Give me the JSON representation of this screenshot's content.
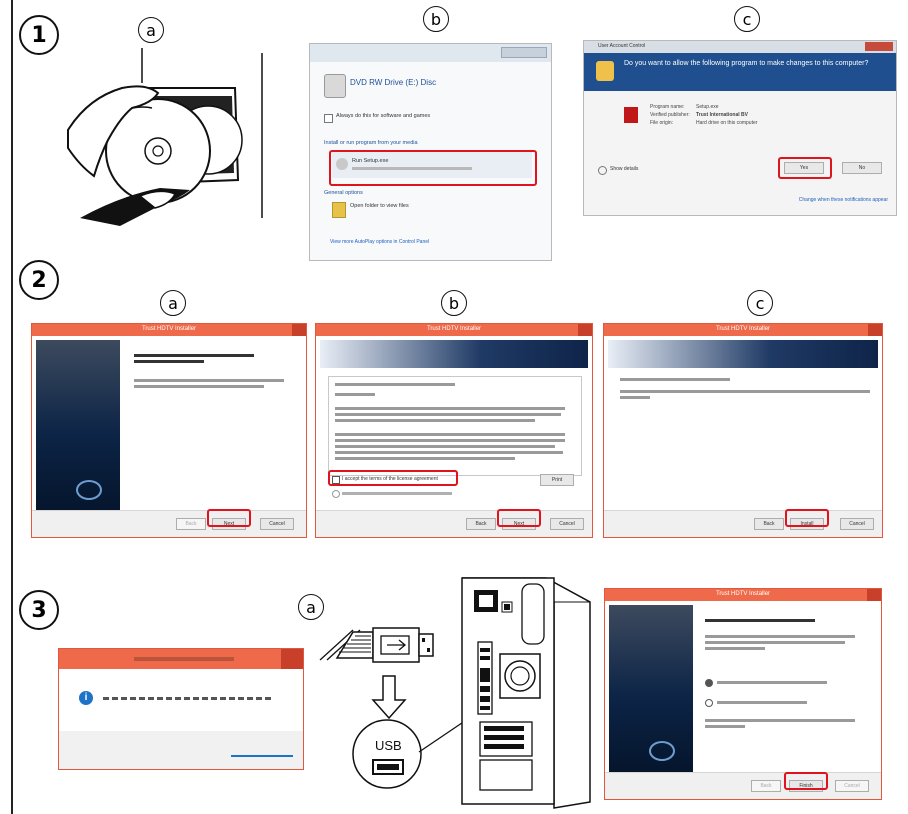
{
  "steps": [
    {
      "number": "1",
      "subs": [
        "a",
        "b",
        "c"
      ]
    },
    {
      "number": "2",
      "subs": [
        "a",
        "b",
        "c"
      ]
    },
    {
      "number": "3",
      "subs": [
        "a"
      ]
    }
  ],
  "autoplay": {
    "drive_title": "DVD RW Drive (E:) Disc",
    "always_do": "Always do this for software and games",
    "install_prompt": "Install or run program from your media",
    "run_item": "Run Setup.exe",
    "general_options": "General options",
    "open_folder": "Open folder to view files",
    "footer_link": "View more AutoPlay options in Control Panel"
  },
  "uac": {
    "title": "User Account Control",
    "question": "Do you want to allow the following program to make changes to this computer?",
    "fields": [
      [
        "Program name:",
        "Setup.exe"
      ],
      [
        "Verified publisher:",
        "Trust International BV"
      ],
      [
        "File origin:",
        "Hard drive on this computer"
      ]
    ],
    "show_details": "Show details",
    "yes": "Yes",
    "no": "No",
    "settings_link": "Change when these notifications appear"
  },
  "installer": {
    "window_title": "Trust HDTV Installer",
    "back": "Back",
    "next": "Next",
    "cancel": "Cancel",
    "install": "Install",
    "print": "Print",
    "finish": "Finish",
    "accept_label": "I accept the terms of the license agreement"
  },
  "usb": {
    "label": "USB"
  },
  "colors": {
    "highlight": "#e0141c",
    "win8_title": "#ef6a4a",
    "uac_header": "#1f4f8f"
  }
}
